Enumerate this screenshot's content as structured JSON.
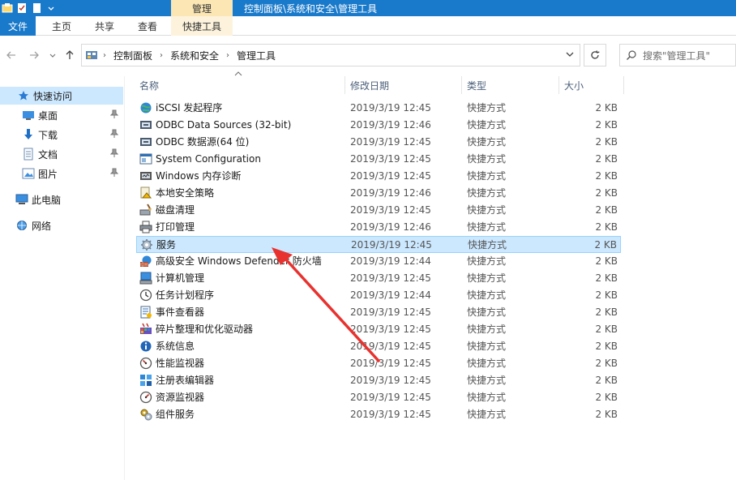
{
  "window": {
    "title": "控制面板\\系统和安全\\管理工具",
    "context_tab_header": "管理",
    "title_bar_color": "#1979ca"
  },
  "ribbon": {
    "tabs": [
      {
        "label": "文件"
      },
      {
        "label": "主页"
      },
      {
        "label": "共享"
      },
      {
        "label": "查看"
      },
      {
        "label": "快捷工具"
      }
    ]
  },
  "address": {
    "crumbs": [
      "控制面板",
      "系统和安全",
      "管理工具"
    ],
    "search_placeholder": "搜索\"管理工具\""
  },
  "nav": {
    "quick_access": "快速访问",
    "desktop": "桌面",
    "downloads": "下载",
    "documents": "文档",
    "pictures": "图片",
    "this_pc": "此电脑",
    "network": "网络"
  },
  "columns": {
    "name": "名称",
    "date": "修改日期",
    "type": "类型",
    "size": "大小"
  },
  "files": [
    {
      "name": "iSCSI 发起程序",
      "date": "2019/3/19 12:45",
      "type": "快捷方式",
      "size": "2 KB",
      "icon": "globe-icon"
    },
    {
      "name": "ODBC Data Sources (32-bit)",
      "date": "2019/3/19 12:46",
      "type": "快捷方式",
      "size": "2 KB",
      "icon": "odbc-icon"
    },
    {
      "name": "ODBC 数据源(64 位)",
      "date": "2019/3/19 12:45",
      "type": "快捷方式",
      "size": "2 KB",
      "icon": "odbc-icon"
    },
    {
      "name": "System Configuration",
      "date": "2019/3/19 12:45",
      "type": "快捷方式",
      "size": "2 KB",
      "icon": "sysconfig-icon"
    },
    {
      "name": "Windows 内存诊断",
      "date": "2019/3/19 12:45",
      "type": "快捷方式",
      "size": "2 KB",
      "icon": "memory-icon"
    },
    {
      "name": "本地安全策略",
      "date": "2019/3/19 12:46",
      "type": "快捷方式",
      "size": "2 KB",
      "icon": "security-policy-icon"
    },
    {
      "name": "磁盘清理",
      "date": "2019/3/19 12:45",
      "type": "快捷方式",
      "size": "2 KB",
      "icon": "disk-cleanup-icon"
    },
    {
      "name": "打印管理",
      "date": "2019/3/19 12:46",
      "type": "快捷方式",
      "size": "2 KB",
      "icon": "printer-icon"
    },
    {
      "name": "服务",
      "date": "2019/3/19 12:45",
      "type": "快捷方式",
      "size": "2 KB",
      "icon": "services-gear-icon"
    },
    {
      "name": "高级安全 Windows Defender 防火墙",
      "date": "2019/3/19 12:44",
      "type": "快捷方式",
      "size": "2 KB",
      "icon": "firewall-icon"
    },
    {
      "name": "计算机管理",
      "date": "2019/3/19 12:45",
      "type": "快捷方式",
      "size": "2 KB",
      "icon": "computer-management-icon"
    },
    {
      "name": "任务计划程序",
      "date": "2019/3/19 12:44",
      "type": "快捷方式",
      "size": "2 KB",
      "icon": "clock-icon"
    },
    {
      "name": "事件查看器",
      "date": "2019/3/19 12:45",
      "type": "快捷方式",
      "size": "2 KB",
      "icon": "event-viewer-icon"
    },
    {
      "name": "碎片整理和优化驱动器",
      "date": "2019/3/19 12:45",
      "type": "快捷方式",
      "size": "2 KB",
      "icon": "defrag-icon"
    },
    {
      "name": "系统信息",
      "date": "2019/3/19 12:45",
      "type": "快捷方式",
      "size": "2 KB",
      "icon": "system-info-icon"
    },
    {
      "name": "性能监视器",
      "date": "2019/3/19 12:45",
      "type": "快捷方式",
      "size": "2 KB",
      "icon": "performance-monitor-icon"
    },
    {
      "name": "注册表编辑器",
      "date": "2019/3/19 12:45",
      "type": "快捷方式",
      "size": "2 KB",
      "icon": "registry-icon"
    },
    {
      "name": "资源监视器",
      "date": "2019/3/19 12:45",
      "type": "快捷方式",
      "size": "2 KB",
      "icon": "resource-monitor-icon"
    },
    {
      "name": "组件服务",
      "date": "2019/3/19 12:45",
      "type": "快捷方式",
      "size": "2 KB",
      "icon": "component-services-icon"
    }
  ],
  "selected_file": "服务",
  "annotation_color": "#e8322f"
}
